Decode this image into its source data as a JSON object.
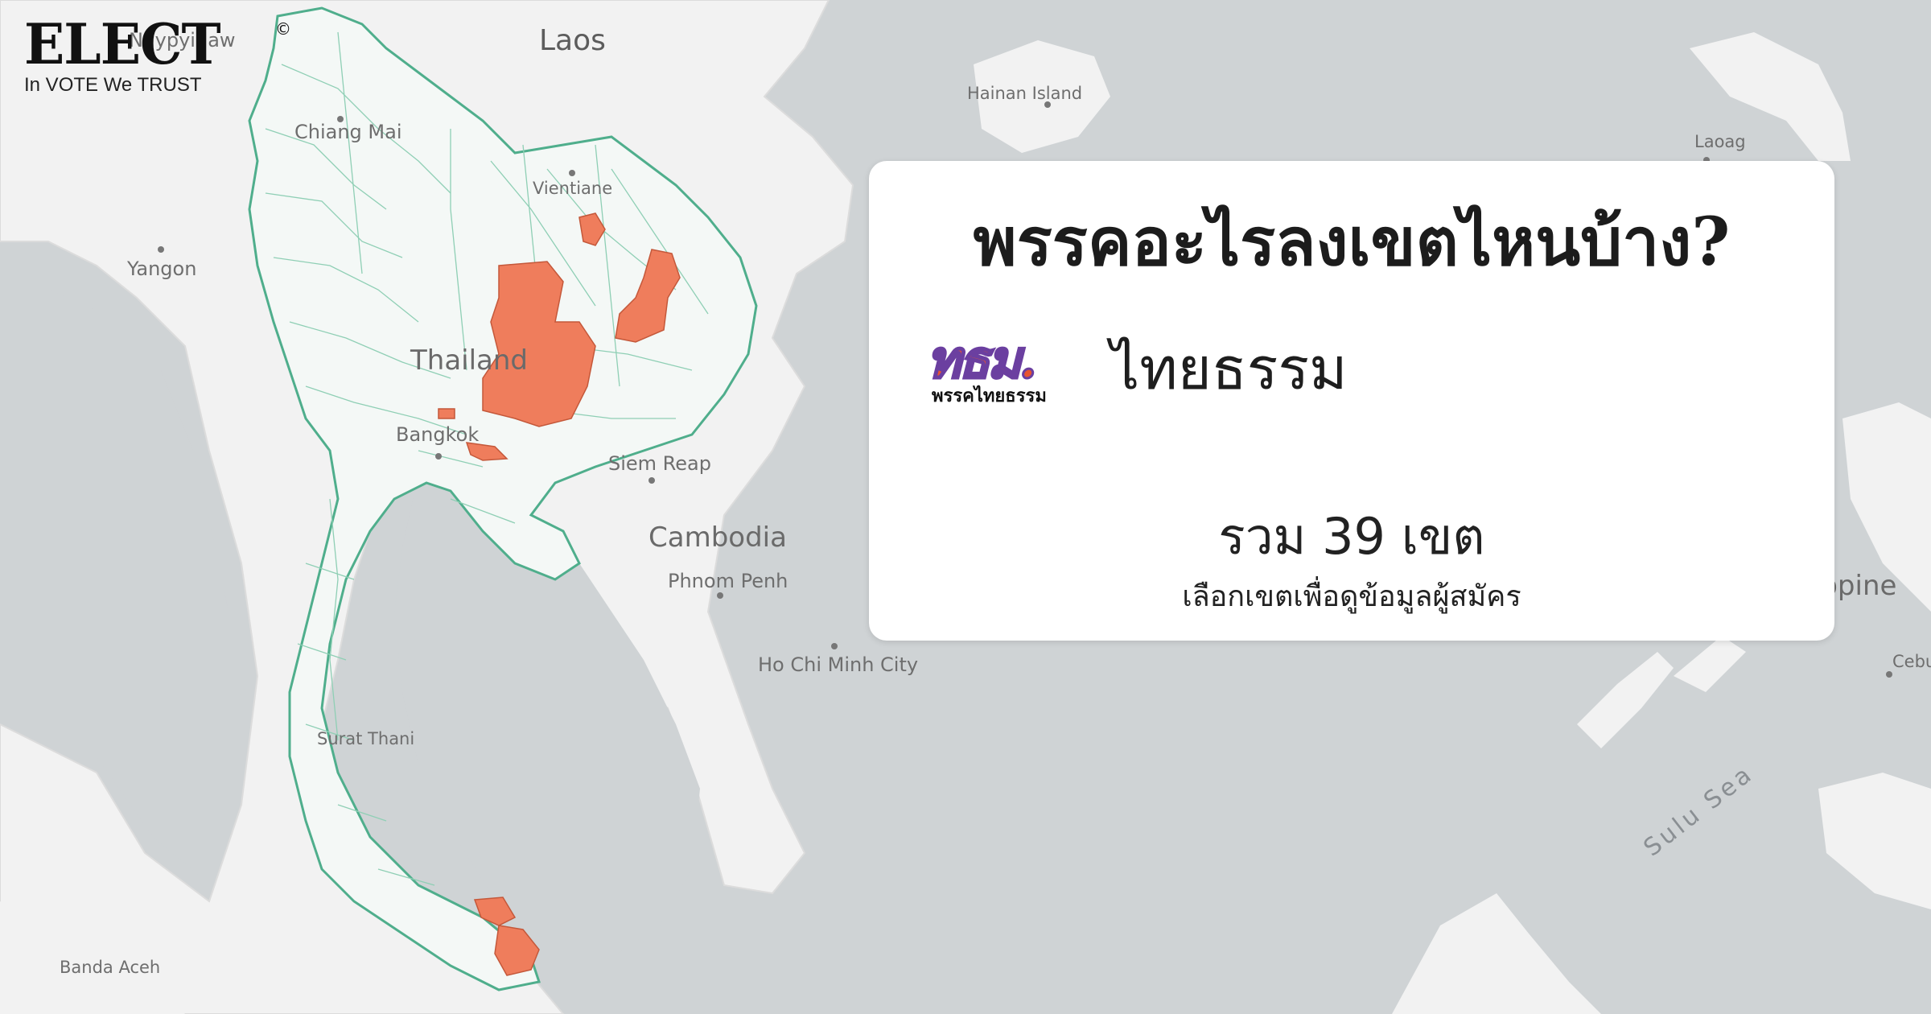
{
  "brand": {
    "name": "ELECT",
    "mark": "©",
    "tagline": "In VOTE We TRUST"
  },
  "card": {
    "title": "พรรคอะไรลงเขตไหนบ้าง?",
    "party_logo_abbr": "ทธม.",
    "party_logo_sub": "พรรคไทยธรรม",
    "party_name": "ไทยธรรม",
    "total_text": "รวม 39 เขต",
    "hint": "เลือกเขตเพื่อดูข้อมูลผู้สมัคร"
  },
  "map": {
    "labels": {
      "laos": "Laos",
      "hainan": "Hainan Island",
      "laoag": "Laoag",
      "chiang_mai": "Chiang Mai",
      "yangon": "Yangon",
      "vientiane": "Vientiane",
      "thailand": "Thailand",
      "bangkok": "Bangkok",
      "siem_reap": "Siem Reap",
      "cambodia": "Cambodia",
      "phnom_penh": "Phnom Penh",
      "ho_chi_minh": "Ho Chi Minh City",
      "philippines": "ilippine",
      "cebu": "Cebu",
      "sulu_sea": "Sulu Sea",
      "surat_thani": "Surat Thani",
      "banda_aceh": "Banda Aceh",
      "naypyidaw": "Naypyidaw"
    },
    "colors": {
      "sea": "#cfd3d5",
      "land": "#f2f2f2",
      "border": "#4fae8c",
      "highlight": "#ef7d5c"
    }
  }
}
